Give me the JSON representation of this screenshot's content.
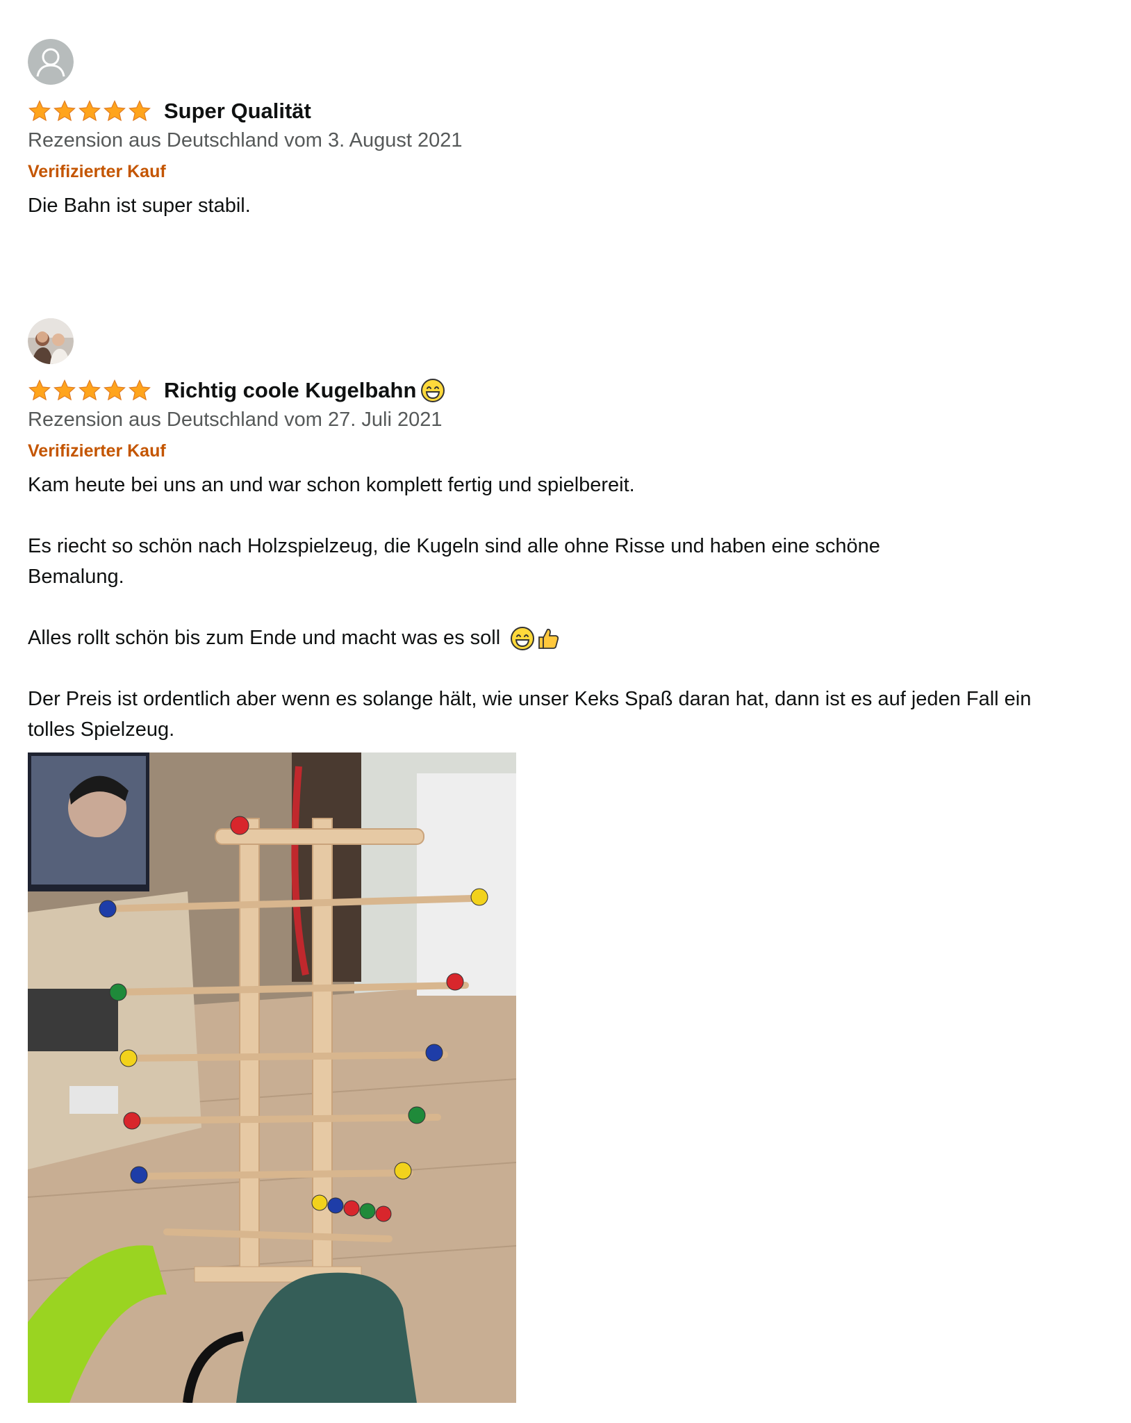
{
  "reviews": [
    {
      "avatar": "default-user-avatar",
      "rating": 5,
      "title": "Super Qualität",
      "title_emoji": "",
      "meta": "Rezension aus Deutschland vom 3. August 2021",
      "verified": "Verifizierter Kauf",
      "paragraphs": [
        "Die Bahn ist super stabil."
      ]
    },
    {
      "avatar": "user-photo-avatar",
      "rating": 5,
      "title": "Richtig coole Kugelbahn",
      "title_emoji": "grinning-face-emoji",
      "meta": "Rezension aus Deutschland vom 27. Juli 2021",
      "verified": "Verifizierter Kauf",
      "paragraphs": [
        "Kam heute bei uns an und war schon komplett fertig und spielbereit.",
        "Es riecht so schön nach Holzspielzeug, die Kugeln sind alle ohne Risse und haben eine schöne Bemalung.",
        "Alles rollt schön bis zum Ende und macht was es soll",
        "Der Preis ist ordentlich aber wenn es solange hält, wie unser Keks Spaß daran hat, dann ist es auf jeden Fall ein tolles Spielzeug."
      ],
      "paragraph_emojis": [
        "",
        "",
        "grinning-face-emoji thumbs-up-emoji",
        ""
      ]
    }
  ],
  "colors": {
    "star": "#ffa41c",
    "verified": "#c45500",
    "meta": "#565959",
    "text": "#0f1111"
  }
}
